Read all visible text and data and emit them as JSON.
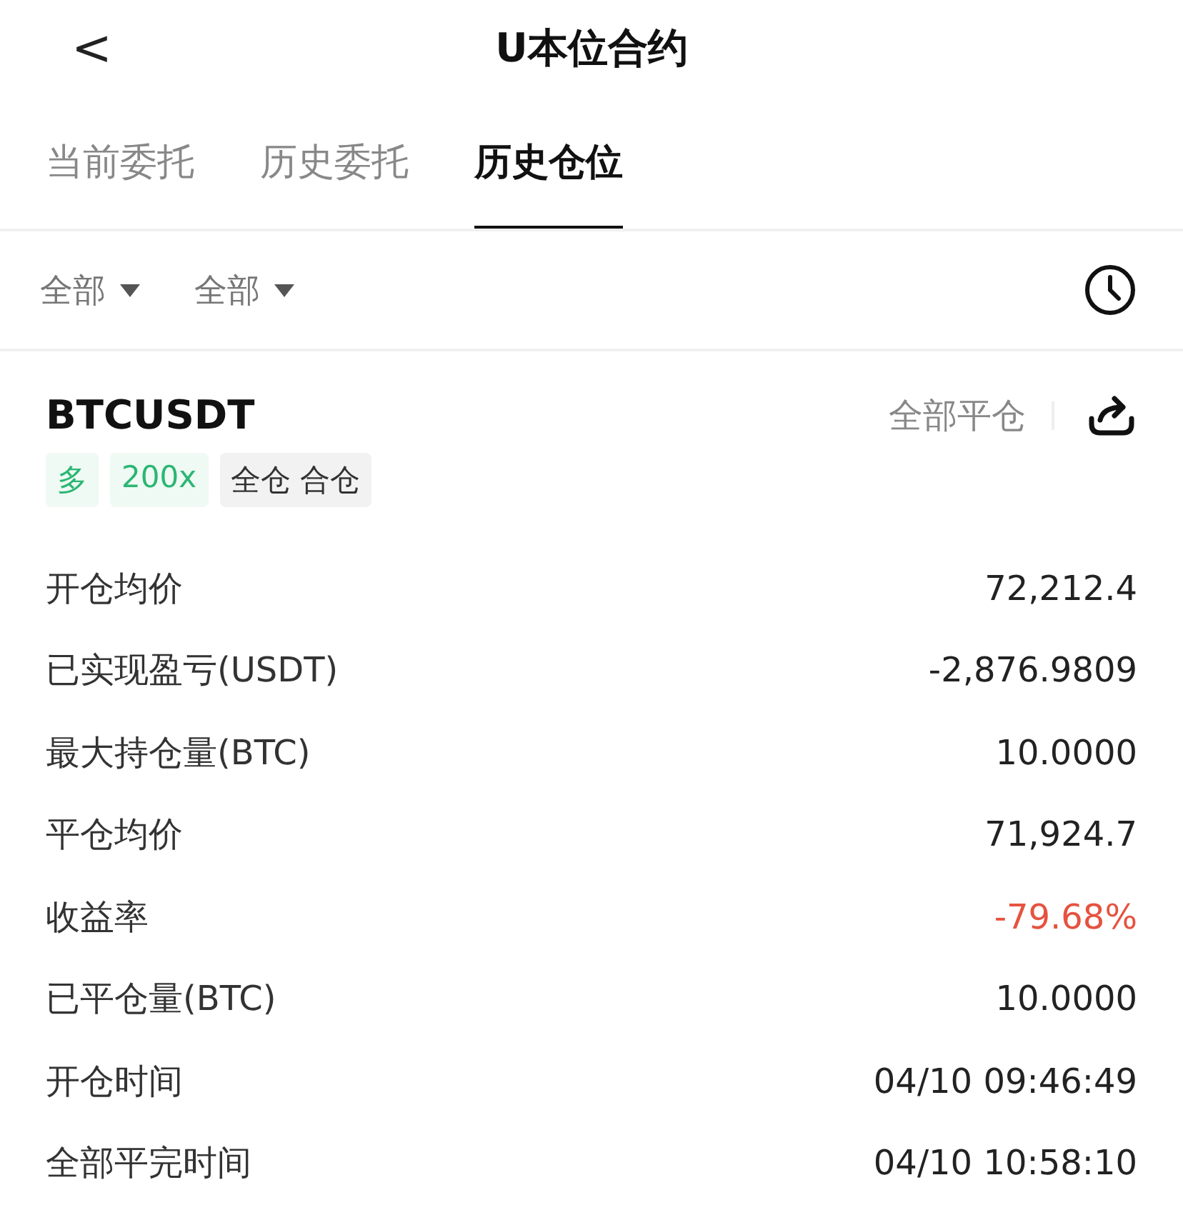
{
  "header": {
    "back": "<",
    "title": "U本位合约"
  },
  "tabs": [
    {
      "label": "当前委托",
      "selected": false
    },
    {
      "label": "历史委托",
      "selected": false
    },
    {
      "label": "历史仓位",
      "selected": true
    }
  ],
  "filters": [
    {
      "label": "全部"
    },
    {
      "label": "全部"
    }
  ],
  "position": {
    "symbol": "BTCUSDT",
    "close_all": "全部平仓",
    "tags": [
      {
        "label": "多",
        "kind": "green"
      },
      {
        "label": "200x",
        "kind": "green"
      },
      {
        "label": "全仓 合仓",
        "kind": "grey"
      }
    ],
    "rows": [
      {
        "label": "开仓均价",
        "value": "72,212.4",
        "color": "#222222"
      },
      {
        "label": "已实现盈亏(USDT)",
        "value": "-2,876.9809",
        "color": "#222222"
      },
      {
        "label": "最大持仓量(BTC)",
        "value": "10.0000",
        "color": "#222222"
      },
      {
        "label": "平仓均价",
        "value": "71,924.7",
        "color": "#222222"
      },
      {
        "label": "收益率",
        "value": "-79.68%",
        "color": "#e5533f"
      },
      {
        "label": "已平仓量(BTC)",
        "value": "10.0000",
        "color": "#222222"
      },
      {
        "label": "开仓时间",
        "value": "04/10 09:46:49",
        "color": "#222222"
      },
      {
        "label": "全部平完时间",
        "value": "04/10 10:58:10",
        "color": "#222222"
      }
    ]
  }
}
